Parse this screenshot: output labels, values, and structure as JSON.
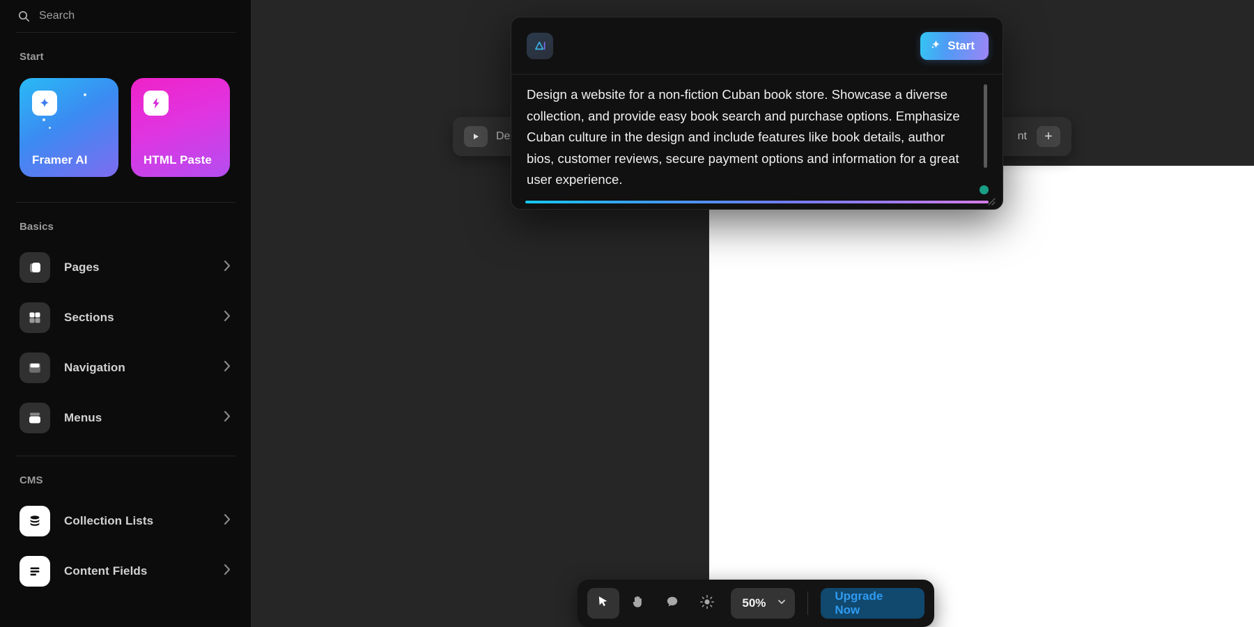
{
  "sidebar": {
    "search": {
      "placeholder": "Search",
      "icon": "search-icon"
    },
    "sections": [
      {
        "title": "Start"
      },
      {
        "title": "Basics"
      },
      {
        "title": "CMS"
      }
    ],
    "start_cards": [
      {
        "label": "Framer AI",
        "icon": "sparkle-icon",
        "color_from": "#29baf5",
        "color_to": "#7e6cf0"
      },
      {
        "label": "HTML Paste",
        "icon": "lightning-bolt-icon",
        "color_from": "#f022c8",
        "color_to": "#b44ef0"
      }
    ],
    "basics_items": [
      {
        "label": "Pages",
        "icon": "page-icon"
      },
      {
        "label": "Sections",
        "icon": "sections-grid-icon"
      },
      {
        "label": "Navigation",
        "icon": "navigation-bar-icon"
      },
      {
        "label": "Menus",
        "icon": "menu-panel-icon"
      }
    ],
    "cms_items": [
      {
        "label": "Collection Lists",
        "icon": "database-stack-icon"
      },
      {
        "label": "Content Fields",
        "icon": "text-lines-icon"
      }
    ],
    "chevron": "›"
  },
  "top_toolbar": {
    "play_icon": "play-icon",
    "left_label": "De",
    "right_label": "nt",
    "add_label": "+"
  },
  "ai_dialog": {
    "logo_text": "ΔI",
    "logo_name": "framer-ai-logo",
    "start_label": "Start",
    "start_icon": "sparkle-icon",
    "prompt": "Design a website for a non-fiction Cuban book store. Showcase a diverse collection, and provide easy book search and purchase options. Emphasize Cuban culture in the design and include features like book details, author bios, customer reviews, secure payment options and information for a great user experience.",
    "status_color": "#1a9e86",
    "progress_from": "#16c8f0",
    "progress_to": "#d67ce8"
  },
  "bottom_toolbar": {
    "tools": [
      {
        "name": "cursor-tool",
        "icon": "cursor-arrow-icon",
        "active": true
      },
      {
        "name": "hand-tool",
        "icon": "hand-icon",
        "active": false
      },
      {
        "name": "comment-tool",
        "icon": "comment-bubble-icon",
        "active": false
      },
      {
        "name": "theme-tool",
        "icon": "sun-icon",
        "active": false
      }
    ],
    "zoom_value": "50%",
    "zoom_chevron": "chevron-down-icon",
    "upgrade_label": "Upgrade Now",
    "upgrade_color": "#2f9bf0"
  }
}
